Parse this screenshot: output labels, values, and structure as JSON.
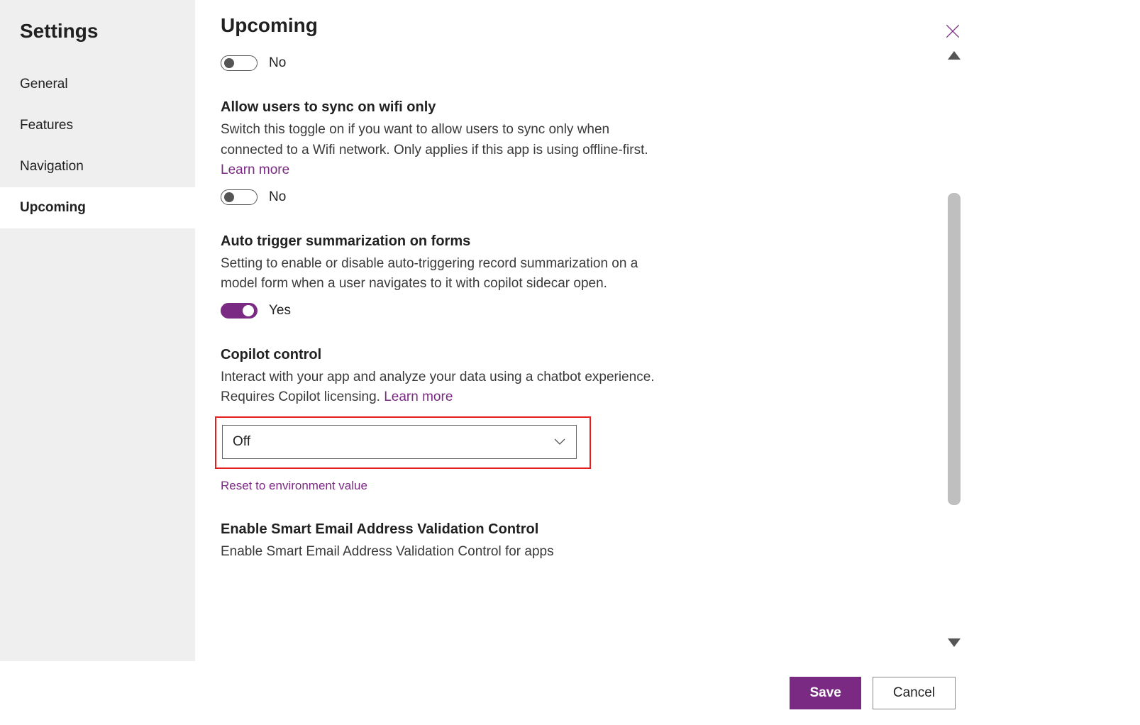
{
  "sidebar": {
    "title": "Settings",
    "items": [
      {
        "label": "General"
      },
      {
        "label": "Features"
      },
      {
        "label": "Navigation"
      },
      {
        "label": "Upcoming"
      }
    ]
  },
  "header": {
    "title": "Upcoming"
  },
  "settings": {
    "unknown_top": {
      "toggle_state_label": "No"
    },
    "wifi_sync": {
      "title": "Allow users to sync on wifi only",
      "desc": "Switch this toggle on if you want to allow users to sync only when connected to a Wifi network. Only applies if this app is using offline-first. ",
      "learn_more": "Learn more",
      "toggle_state_label": "No"
    },
    "auto_summarize": {
      "title": "Auto trigger summarization on forms",
      "desc": "Setting to enable or disable auto-triggering record summarization on a model form when a user navigates to it with copilot sidecar open.",
      "toggle_state_label": "Yes"
    },
    "copilot_control": {
      "title": "Copilot control",
      "desc": "Interact with your app and analyze your data using a chatbot experience. Requires Copilot licensing. ",
      "learn_more": "Learn more",
      "selected": "Off",
      "reset_link": "Reset to environment value"
    },
    "smart_email": {
      "title": "Enable Smart Email Address Validation Control",
      "desc": "Enable Smart Email Address Validation Control for apps"
    }
  },
  "footer": {
    "save": "Save",
    "cancel": "Cancel"
  }
}
